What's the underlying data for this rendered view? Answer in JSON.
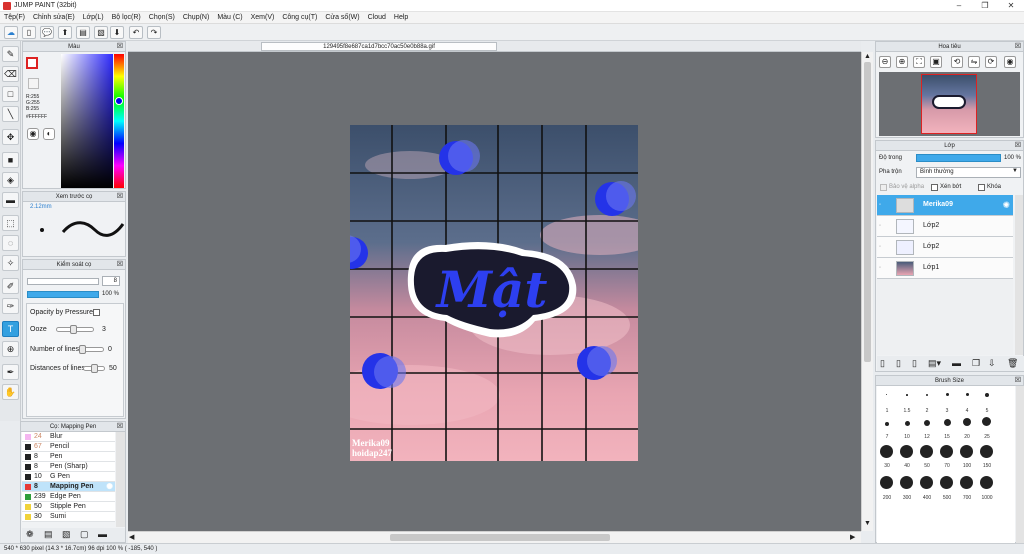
{
  "app": {
    "title": "JUMP PAINT (32bit)"
  },
  "menu": [
    "Tệp(F)",
    "Chỉnh sửa(E)",
    "Lớp(L)",
    "Bộ lọc(R)",
    "Chọn(S)",
    "Chụp(N)",
    "Màu (C)",
    "Xem(V)",
    "Công cụ(T)",
    "Cửa số(W)",
    "Cloud",
    "Help"
  ],
  "doc": {
    "tab": "129495f8e687ca1d7bcc70ac50e0b88a.gif"
  },
  "color_panel": {
    "title": "Màu",
    "r": "R:255",
    "g": "G:255",
    "b": "B:255",
    "hex": "#FFFFFF"
  },
  "brush_preview": {
    "title": "Xem trước cọ",
    "size": "2.12mm"
  },
  "brush_control": {
    "title": "Kiểm soát cọ",
    "size_value": "8",
    "opacity_value": "100 %",
    "opacity_by_pressure": "Opacity by Pressure",
    "ooze": "Ooze",
    "ooze_value": "3",
    "number_of_lines": "Number of lines",
    "number_of_lines_value": "0",
    "distances_of_lines": "Distances of lines",
    "distances_of_lines_value": "50"
  },
  "brush_list": {
    "title": "Cọ: Mapping Pen",
    "items": [
      {
        "size": "24",
        "label": "Blur",
        "color": "#f4b6f0"
      },
      {
        "size": "67",
        "label": "Pencil",
        "color": "#222222"
      },
      {
        "size": "8",
        "label": "Pen",
        "color": "#222222"
      },
      {
        "size": "8",
        "label": "Pen (Sharp)",
        "color": "#222222"
      },
      {
        "size": "10",
        "label": "G Pen",
        "color": "#222222"
      },
      {
        "size": "8",
        "label": "Mapping Pen",
        "color": "#e53935"
      },
      {
        "size": "239",
        "label": "Edge Pen",
        "color": "#2e9e3a"
      },
      {
        "size": "50",
        "label": "Stipple Pen",
        "color": "#f0d23a"
      },
      {
        "size": "30",
        "label": "Sumi",
        "color": "#f0d23a"
      }
    ]
  },
  "navigator": {
    "title": "Hoa tiêu"
  },
  "layers": {
    "title": "Lớp",
    "opacity_label": "Độ trong",
    "opacity_value": "100 %",
    "blend_label": "Pha trộn",
    "blend_value": "Bình thường",
    "protect_alpha": "Bảo vệ alpha",
    "clipping": "Xén bớt",
    "lock": "Khóa",
    "items": [
      {
        "name": "Merika09"
      },
      {
        "name": "Lớp2"
      },
      {
        "name": "Lớp2"
      },
      {
        "name": "Lớp1"
      }
    ]
  },
  "brush_size": {
    "title": "Brush Size",
    "sizes": [
      "1",
      "1.5",
      "2",
      "3",
      "4",
      "5",
      "7",
      "10",
      "12",
      "15",
      "20",
      "25",
      "30",
      "40",
      "50",
      "70",
      "100",
      "150",
      "200",
      "300",
      "400",
      "500",
      "700",
      "1000"
    ]
  },
  "artwork": {
    "text": "Mật",
    "watermark1": "Merika09",
    "watermark2": "hoidap247"
  },
  "status": {
    "text": "540 * 630 pixel   (14.3 * 16.7cm)   96 dpi   100 %   ( -185, 540 )"
  },
  "colors": {
    "accent": "#3fa9ea",
    "canvas_bg": "#6c6f73",
    "circle": "#2433e8"
  }
}
